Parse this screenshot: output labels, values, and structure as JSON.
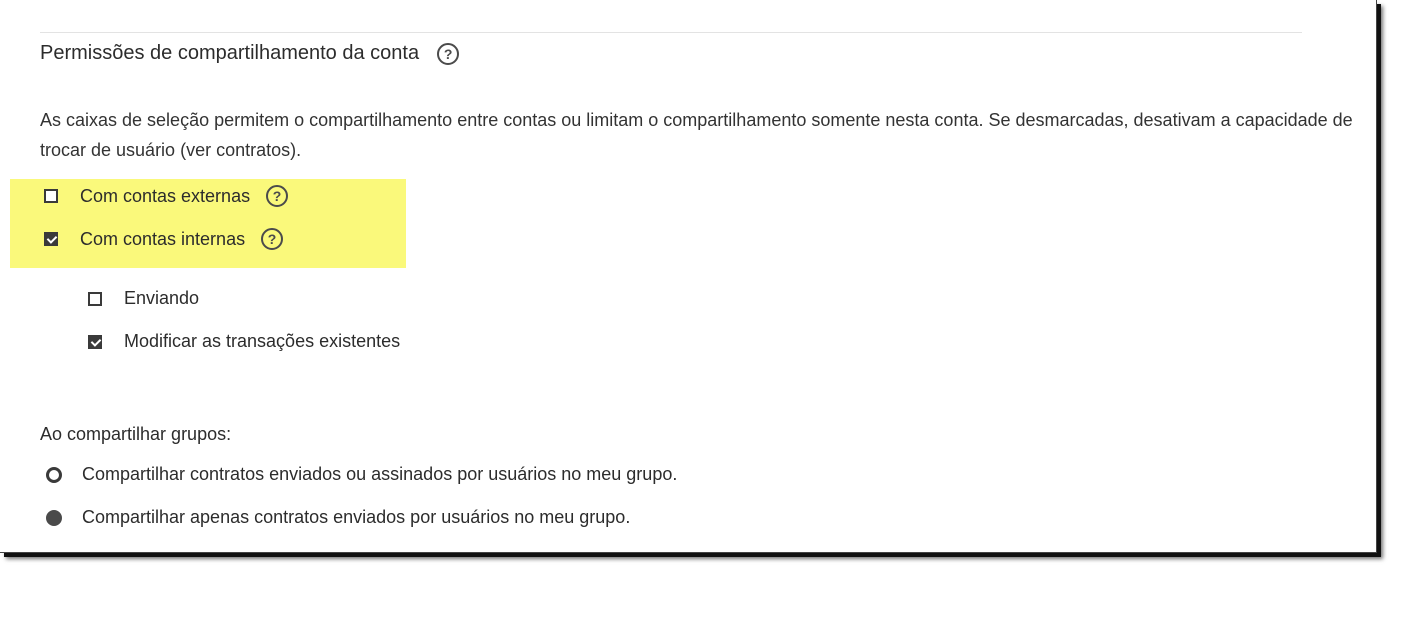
{
  "section": {
    "title": "Permissões de compartilhamento da conta",
    "help_glyph": "?",
    "description": "As caixas de seleção permitem o compartilhamento entre contas ou limitam o compartilhamento somente nesta conta. Se desmarcadas, desativam a capacidade de trocar de usuário (ver contratos)."
  },
  "account_sharing": {
    "external": {
      "label": "Com contas externas",
      "checked": false
    },
    "internal": {
      "label": "Com contas internas",
      "checked": true
    },
    "highlight_color": "#faf97b"
  },
  "internal_options": {
    "sending": {
      "label": "Enviando",
      "checked": false
    },
    "modify": {
      "label": "Modificar as transações existentes",
      "checked": true
    }
  },
  "group_sharing": {
    "label": "Ao compartilhar grupos:",
    "options": [
      {
        "label": "Compartilhar contratos enviados ou assinados por usuários no meu grupo.",
        "selected": false
      },
      {
        "label": "Compartilhar apenas contratos enviados por usuários no meu grupo.",
        "selected": true
      }
    ]
  }
}
